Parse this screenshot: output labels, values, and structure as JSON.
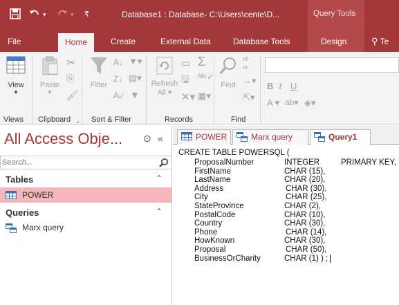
{
  "titlebar": {
    "title": "Database1 : Database- C:\\Users\\cente\\D...",
    "query_tools": "Query Tools"
  },
  "ribbon_tabs": [
    "File",
    "Home",
    "Create",
    "External Data",
    "Database Tools",
    "Design",
    "Te"
  ],
  "ribbon": {
    "view": "View",
    "paste": "Paste",
    "filter": "Filter",
    "refresh_1": "Refresh",
    "refresh_2": "All",
    "find": "Find",
    "groups": {
      "views": "Views",
      "clipboard": "Clipboard",
      "sort_filter": "Sort & Filter",
      "records": "Records",
      "find": "Find"
    }
  },
  "nav": {
    "header": "All Access Obje...",
    "search_placeholder": "Search...",
    "sections": [
      {
        "label": "Tables",
        "items": [
          "POWER"
        ]
      },
      {
        "label": "Queries",
        "items": [
          "Marx query"
        ]
      }
    ]
  },
  "doc_tabs": [
    "POWER",
    "Marx query",
    "Query1"
  ],
  "sql": {
    "first_line": "CREATE TABLE POWERSQL (",
    "fields": [
      {
        "name": "ProposalNumber",
        "type": "INTEGER",
        "extra": "PRIMARY KEY,"
      },
      {
        "name": "FirstName",
        "type": "CHAR (15),"
      },
      {
        "name": "LastName",
        "type": "CHAR (20),"
      },
      {
        "name": "Address",
        "type": "CHAR (30),"
      },
      {
        "name": "City",
        "type": "CHAR (25),"
      },
      {
        "name": "StateProvince",
        "type": "CHAR (2),"
      },
      {
        "name": "PostalCode",
        "type": "CHAR (10),"
      },
      {
        "name": "Country",
        "type": "CHAR (30),"
      },
      {
        "name": "Phone",
        "type": "CHAR (14),"
      },
      {
        "name": "HowKnown",
        "type": "CHAR (30),"
      },
      {
        "name": "Proposal",
        "type": "CHAR (50),"
      },
      {
        "name": "BusinessOrCharity",
        "type": "CHAR (1) ) ;"
      }
    ]
  },
  "colors": {
    "accent": "#a4373a",
    "ribbon_bg": "#f3f3f3",
    "selection": "#f4b6b8"
  }
}
